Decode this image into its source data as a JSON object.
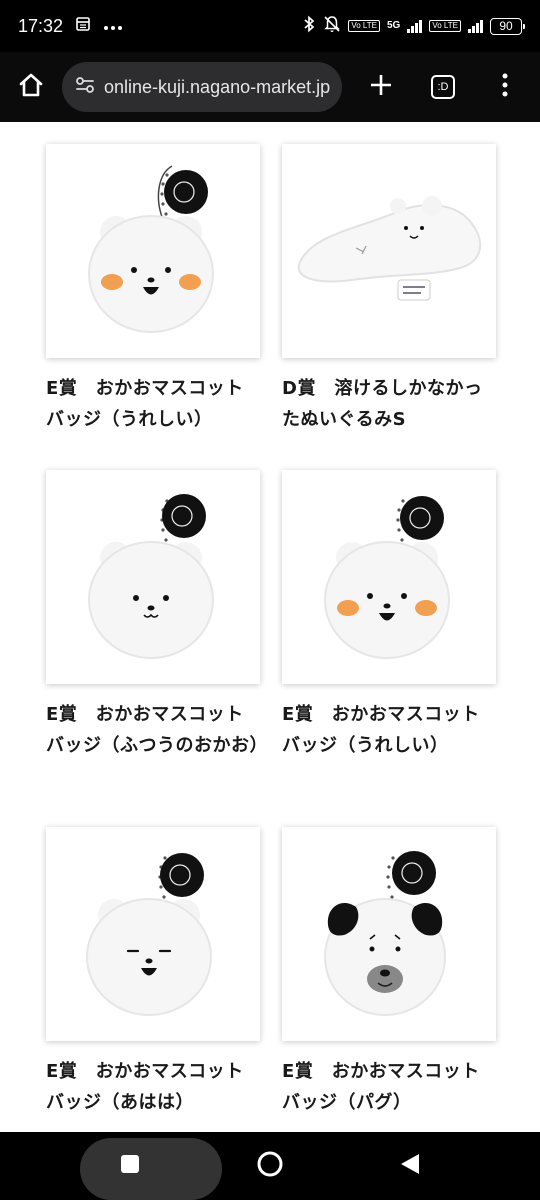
{
  "status_bar": {
    "time": "17:32",
    "battery": "90",
    "network": "5G",
    "volte_label": "Vo LTE",
    "icons": [
      "calendar-icon",
      "more-dots-icon",
      "bluetooth-icon",
      "silent-bell-icon",
      "signal-icon",
      "battery-icon"
    ]
  },
  "browser": {
    "url": "online-kuji.nagano-market.jp",
    "tab_count": ":D",
    "icons": [
      "home-icon",
      "site-settings-icon",
      "new-tab-plus-icon",
      "tab-switcher-icon",
      "menu-kebab-icon"
    ]
  },
  "products": [
    {
      "title": "E賞　おかおマスコットバッジ（うれしい）",
      "image": "bear-face-happy-mascot"
    },
    {
      "title": "D賞　溶けるしかなかったぬいぐるみS",
      "image": "melted-bear-plush"
    },
    {
      "title": "E賞　おかおマスコットバッジ（ふつうのおかお）",
      "image": "bear-face-normal-mascot"
    },
    {
      "title": "E賞　おかおマスコットバッジ（うれしい）",
      "image": "bear-face-happy-mascot"
    },
    {
      "title": "E賞　おかおマスコットバッジ（あはは）",
      "image": "bear-face-laughing-mascot"
    },
    {
      "title": "E賞　おかおマスコットバッジ（パグ）",
      "image": "pug-face-mascot"
    }
  ],
  "system_nav": {
    "icons": [
      "recents-square-icon",
      "home-circle-icon",
      "back-triangle-icon"
    ]
  },
  "colors": {
    "page_bg": "#ffffff",
    "toolbar_bg": "#0b0b0b",
    "url_bar_bg": "#2d2d30",
    "cheek_orange": "#f0a050",
    "text": "#1a1a1a"
  }
}
